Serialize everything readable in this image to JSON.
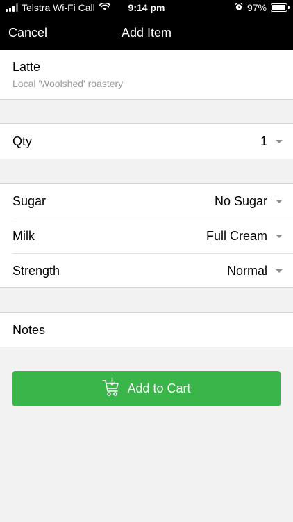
{
  "status_bar": {
    "carrier": "Telstra Wi-Fi Call",
    "time": "9:14 pm",
    "battery": "97%",
    "battery_level": 0.97,
    "icons": [
      "signal-icon",
      "wifi-icon",
      "alarm-icon",
      "battery-icon"
    ]
  },
  "nav": {
    "cancel_label": "Cancel",
    "title": "Add Item"
  },
  "item": {
    "name": "Latte",
    "description": "Local 'Woolshed' roastery"
  },
  "qty": {
    "label": "Qty",
    "value": "1"
  },
  "options": [
    {
      "label": "Sugar",
      "value": "No Sugar"
    },
    {
      "label": "Milk",
      "value": "Full Cream"
    },
    {
      "label": "Strength",
      "value": "Normal"
    }
  ],
  "notes": {
    "label": "Notes"
  },
  "cart": {
    "button_label": "Add to Cart",
    "icon": "cart-icon"
  },
  "colors": {
    "accent": "#3ab54a",
    "nav_background": "#000000",
    "page_background": "#f2f2f2"
  }
}
